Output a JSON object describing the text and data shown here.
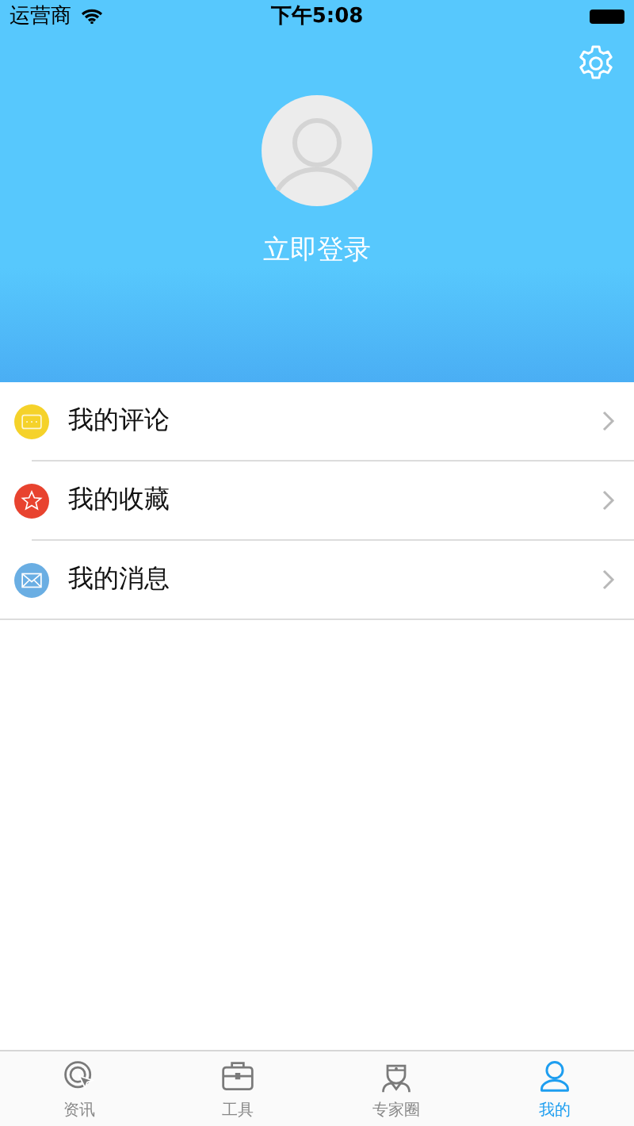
{
  "status_bar": {
    "carrier": "运营商",
    "time": "下午5:08"
  },
  "header": {
    "login": "立即登录"
  },
  "menu": [
    {
      "label": "我的评论",
      "kind": "comment",
      "color": "#f5d22a"
    },
    {
      "label": "我的收藏",
      "kind": "star",
      "color": "#e8432f"
    },
    {
      "label": "我的消息",
      "kind": "mail",
      "color": "#6aaee3"
    }
  ],
  "tabs": [
    {
      "label": "资讯",
      "kind": "news",
      "selected": false
    },
    {
      "label": "工具",
      "kind": "tools",
      "selected": false
    },
    {
      "label": "专家圈",
      "kind": "expert",
      "selected": false
    },
    {
      "label": "我的",
      "kind": "me",
      "selected": true
    }
  ]
}
